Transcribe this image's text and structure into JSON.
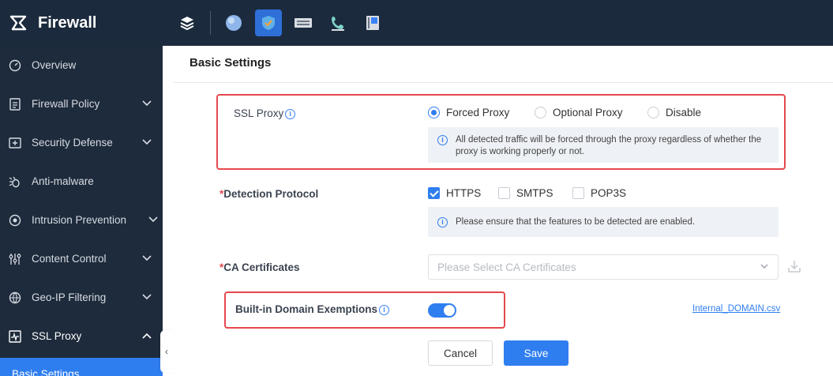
{
  "app": {
    "title": "Firewall"
  },
  "topnav": {
    "icons": [
      "layers-icon",
      "globe-icon",
      "shield-icon",
      "switch-icon",
      "phone-icon",
      "device-icon"
    ],
    "active": "shield-icon"
  },
  "sidebar": {
    "items": [
      {
        "label": "Overview",
        "icon": "gauge-icon"
      },
      {
        "label": "Firewall Policy",
        "icon": "document-icon"
      },
      {
        "label": "Security Defense",
        "icon": "shield-plus-icon"
      },
      {
        "label": "Anti-malware",
        "icon": "bug-icon"
      },
      {
        "label": "Intrusion Prevention",
        "icon": "target-icon"
      },
      {
        "label": "Content Control",
        "icon": "filter-icon"
      },
      {
        "label": "Geo-IP Filtering",
        "icon": "globe-icon"
      },
      {
        "label": "SSL Proxy",
        "icon": "pulse-icon"
      }
    ],
    "sub_item": "Basic Settings",
    "collapse_glyph": "‹"
  },
  "page": {
    "title": "Basic Settings",
    "ssl_proxy": {
      "label": "SSL Proxy",
      "options": [
        "Forced Proxy",
        "Optional Proxy",
        "Disable"
      ],
      "selected": "Forced Proxy",
      "note": "All detected traffic will be forced through the proxy regardless of whether the proxy is working properly or not."
    },
    "detection_protocol": {
      "required_mark": "*",
      "label": "Detection Protocol",
      "options": [
        "HTTPS",
        "SMTPS",
        "POP3S"
      ],
      "checked": [
        "HTTPS"
      ],
      "note": "Please ensure that the features to be detected are enabled."
    },
    "ca_certificates": {
      "required_mark": "*",
      "label": "CA Certificates",
      "placeholder": "Please Select CA Certificates"
    },
    "domain_exemptions": {
      "label": "Built-in Domain Exemptions",
      "enabled": true,
      "link": "Internal_DOMAIN.csv"
    },
    "buttons": {
      "cancel": "Cancel",
      "save": "Save"
    }
  },
  "colors": {
    "accent": "#2f7ef0",
    "sidebar_bg": "#1e2b3c",
    "highlight": "#e5484d"
  }
}
